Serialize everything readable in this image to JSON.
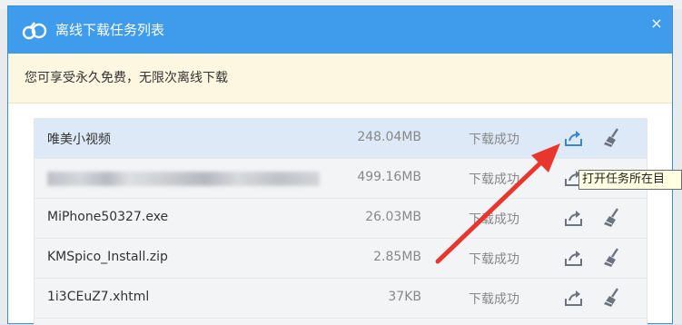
{
  "dialog": {
    "title": "离线下载任务列表",
    "notice": "您可享受永久免费，无限次离线下载",
    "close_glyph": "×"
  },
  "tasks": [
    {
      "name": "唯美小视频",
      "size": "248.04MB",
      "status": "下载成功",
      "selected": true
    },
    {
      "name": "",
      "size": "499.16MB",
      "status": "下载成功",
      "blurred": true
    },
    {
      "name": "MiPhone50327.exe",
      "size": "26.03MB",
      "status": "下载成功"
    },
    {
      "name": "KMSpico_Install.zip",
      "size": "2.85MB",
      "status": "下载成功"
    },
    {
      "name": "1i3CEuZ7.xhtml",
      "size": "37KB",
      "status": "下载成功"
    }
  ],
  "tooltip": "打开任务所在目",
  "icons": {
    "title": "cloud-icon",
    "open_folder": "open-folder-icon",
    "clean": "broom-icon",
    "close": "close-icon"
  },
  "colors": {
    "titlebar": "#3f9bec",
    "notice_bg": "#fdf6e0",
    "selected_row": "#dde9f6",
    "annotation_arrow": "#e8352e"
  }
}
